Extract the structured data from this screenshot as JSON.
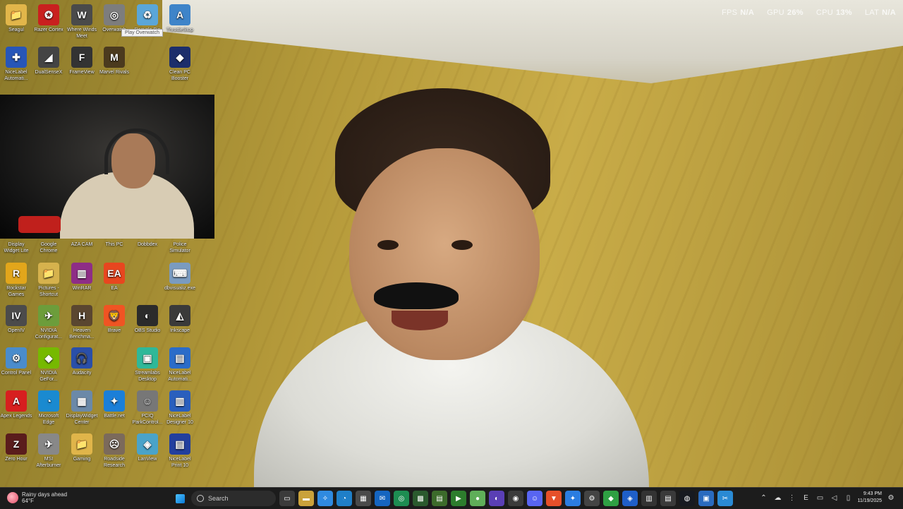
{
  "overlay": {
    "fps_label": "FPS",
    "fps_value": "N/A",
    "gpu_label": "GPU",
    "gpu_value": "26%",
    "cpu_label": "CPU",
    "cpu_value": "13%",
    "lat_label": "LAT",
    "lat_value": "N/A"
  },
  "tooltip": "Play Overwatch",
  "desktop_icons": [
    {
      "label": "Seagul",
      "glyph": "📁",
      "color": "#e2b64a"
    },
    {
      "label": "Razer Cortex",
      "glyph": "✪",
      "color": "#c9201f"
    },
    {
      "label": "Where Winds Meet",
      "glyph": "W",
      "color": "#4a4a4a"
    },
    {
      "label": "Overwatch",
      "glyph": "◎",
      "color": "#7d7d7d"
    },
    {
      "label": "Recycle Bin",
      "glyph": "♻",
      "color": "#5aa6d8"
    },
    {
      "label": "ThrottleStop",
      "glyph": "A",
      "color": "#3e84c9"
    },
    {
      "label": "NiceLabel Automati...",
      "glyph": "✚",
      "color": "#2756b8"
    },
    {
      "label": "DualSenseX",
      "glyph": "◢",
      "color": "#444"
    },
    {
      "label": "FrameView",
      "glyph": "F",
      "color": "#333"
    },
    {
      "label": "Marvel Rivals",
      "glyph": "M",
      "color": "#4b3a1e"
    },
    {
      "label": "Clean PC Booster",
      "glyph": "◆",
      "color": "#1c2e6b"
    },
    {
      "label": "Display Widget Lite",
      "glyph": "▭",
      "color": "#777"
    },
    {
      "label": "Google Chrome",
      "glyph": "◉",
      "color": "#3a7ed8"
    },
    {
      "label": "AZA CAM",
      "glyph": "●",
      "color": "#333"
    },
    {
      "label": "This PC",
      "glyph": "🖥",
      "color": "#4a86c5"
    },
    {
      "label": "Dobbdex",
      "glyph": "D",
      "color": "#555"
    },
    {
      "label": "Police Simulator",
      "glyph": "P",
      "color": "#333"
    },
    {
      "label": "Rockstar Games Launcher",
      "glyph": "R",
      "color": "#e2a61b"
    },
    {
      "label": "Pictures - Shortcut",
      "glyph": "📁",
      "color": "#d6b24d"
    },
    {
      "label": "WinRAR",
      "glyph": "▥",
      "color": "#8e2d86"
    },
    {
      "label": "EA",
      "glyph": "EA",
      "color": "#e8461f"
    },
    {
      "label": "dbvisualiz.exe",
      "glyph": "⌨",
      "color": "#7a9bc0"
    },
    {
      "label": "OpenIV",
      "glyph": "IV",
      "color": "#4b4b4b"
    },
    {
      "label": "NVIDIA Configurat...",
      "glyph": "✈",
      "color": "#6c9d3b"
    },
    {
      "label": "Heaven Benchma...",
      "glyph": "H",
      "color": "#5a4630"
    },
    {
      "label": "Brave",
      "glyph": "🦁",
      "color": "#f05423"
    },
    {
      "label": "OBS Studio",
      "glyph": "◐",
      "color": "#2b2b2b"
    },
    {
      "label": "Inkscape",
      "glyph": "◭",
      "color": "#3a3a3a"
    },
    {
      "label": "Control Panel",
      "glyph": "⚙",
      "color": "#4a8ccc"
    },
    {
      "label": "NVIDIA GeFor...",
      "glyph": "◆",
      "color": "#76b900"
    },
    {
      "label": "Audacity",
      "glyph": "🎧",
      "color": "#2a4fa8"
    },
    {
      "label": "Streamlabs Desktop",
      "glyph": "▣",
      "color": "#2fb899"
    },
    {
      "label": "NiceLabel Automati...",
      "glyph": "▤",
      "color": "#2a6cc9"
    },
    {
      "label": "Apex Legends",
      "glyph": "A",
      "color": "#d71f1f"
    },
    {
      "label": "Microsoft Edge",
      "glyph": "◔",
      "color": "#1a8ad0"
    },
    {
      "label": "DisplayWidget Center",
      "glyph": "▦",
      "color": "#6b89a8"
    },
    {
      "label": "Battle.net",
      "glyph": "✦",
      "color": "#1b7fd8"
    },
    {
      "label": "PCIQ ParkControl...",
      "glyph": "☺",
      "color": "#777"
    },
    {
      "label": "NiceLabel Designer 10",
      "glyph": "▥",
      "color": "#2a5fbd"
    },
    {
      "label": "Zero Hour",
      "glyph": "Z",
      "color": "#5a1c1c"
    },
    {
      "label": "MSI Afterburner",
      "glyph": "✈",
      "color": "#888"
    },
    {
      "label": "Gaming",
      "glyph": "📁",
      "color": "#e0b54a"
    },
    {
      "label": "Roadside Research",
      "glyph": "☹",
      "color": "#7b6a5b"
    },
    {
      "label": "LanView",
      "glyph": "◈",
      "color": "#4aa3c9"
    },
    {
      "label": "NiceLabel Print 10",
      "glyph": "▤",
      "color": "#223f9e"
    }
  ],
  "taskbar": {
    "weather_title": "Rainy days ahead",
    "weather_temp": "64°F",
    "search_placeholder": "Search",
    "time": "9:43 PM",
    "date": "11/19/2025",
    "tray_lang": "E"
  }
}
